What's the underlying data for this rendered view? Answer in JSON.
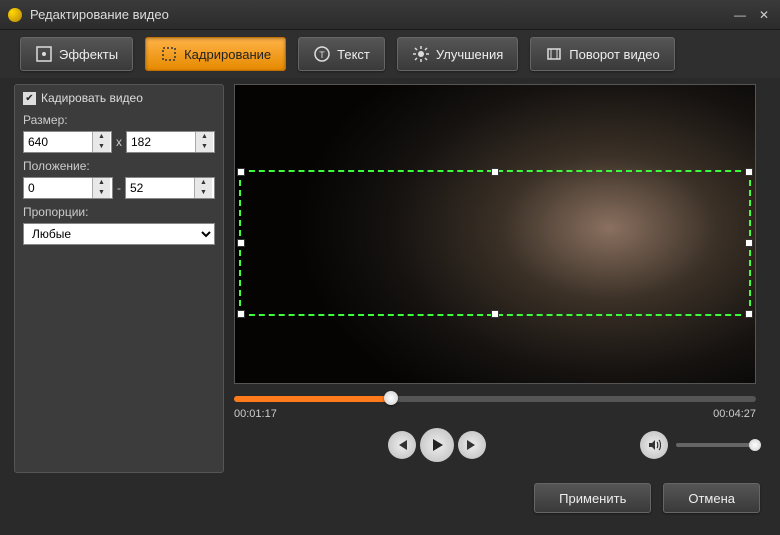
{
  "window": {
    "title": "Редактирование видео"
  },
  "tabs": {
    "effects": "Эффекты",
    "crop": "Кадрирование",
    "text": "Текст",
    "enhance": "Улучшения",
    "rotate": "Поворот видео"
  },
  "sidebar": {
    "crop_check": "Кадировать видео",
    "size_label": "Размер:",
    "width": "640",
    "height": "182",
    "size_sep": "x",
    "position_label": "Положение:",
    "pos_x": "0",
    "pos_y": "52",
    "pos_sep": "-",
    "aspect_label": "Пропорции:",
    "aspect_value": "Любые"
  },
  "player": {
    "current": "00:01:17",
    "total": "00:04:27"
  },
  "footer": {
    "apply": "Применить",
    "cancel": "Отмена"
  }
}
